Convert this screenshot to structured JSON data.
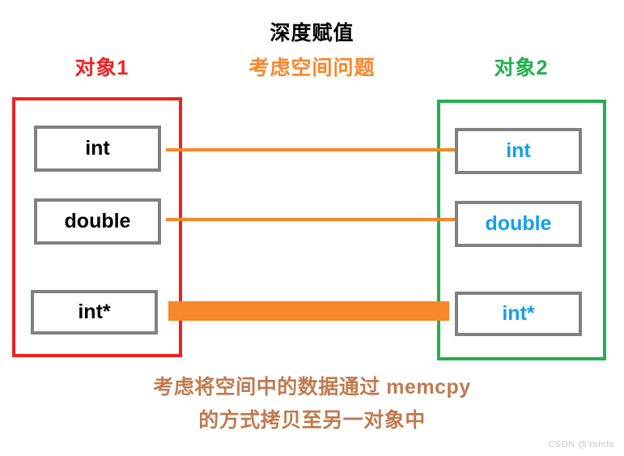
{
  "diagram": {
    "title": "深度赋值",
    "subtitle": "考虑空间问题",
    "left_object_label": "对象1",
    "right_object_label": "对象2",
    "colors": {
      "left_border": "#ee2121",
      "right_border": "#22b04e",
      "connector": "#f8862a",
      "slot_border": "#808080",
      "left_text": "#000000",
      "right_text": "#12a0e8",
      "title": "#000000",
      "subtitle": "#f8862a",
      "footer": "#bf7b51"
    },
    "left_members": [
      {
        "name": "int"
      },
      {
        "name": "double"
      },
      {
        "name": "int*"
      }
    ],
    "right_members": [
      {
        "name": "int"
      },
      {
        "name": "double"
      },
      {
        "name": "int*"
      }
    ],
    "connectors": [
      {
        "from": "int",
        "to": "int",
        "style": "thin-line"
      },
      {
        "from": "double",
        "to": "double",
        "style": "thin-line"
      },
      {
        "from": "int*",
        "to": "int*",
        "style": "thick-bar"
      }
    ],
    "footer_lines": [
      "考虑将空间中的数据通过 memcpy",
      "的方式拷贝至另一对象中"
    ]
  },
  "watermark": "CSDN @Yohifo"
}
